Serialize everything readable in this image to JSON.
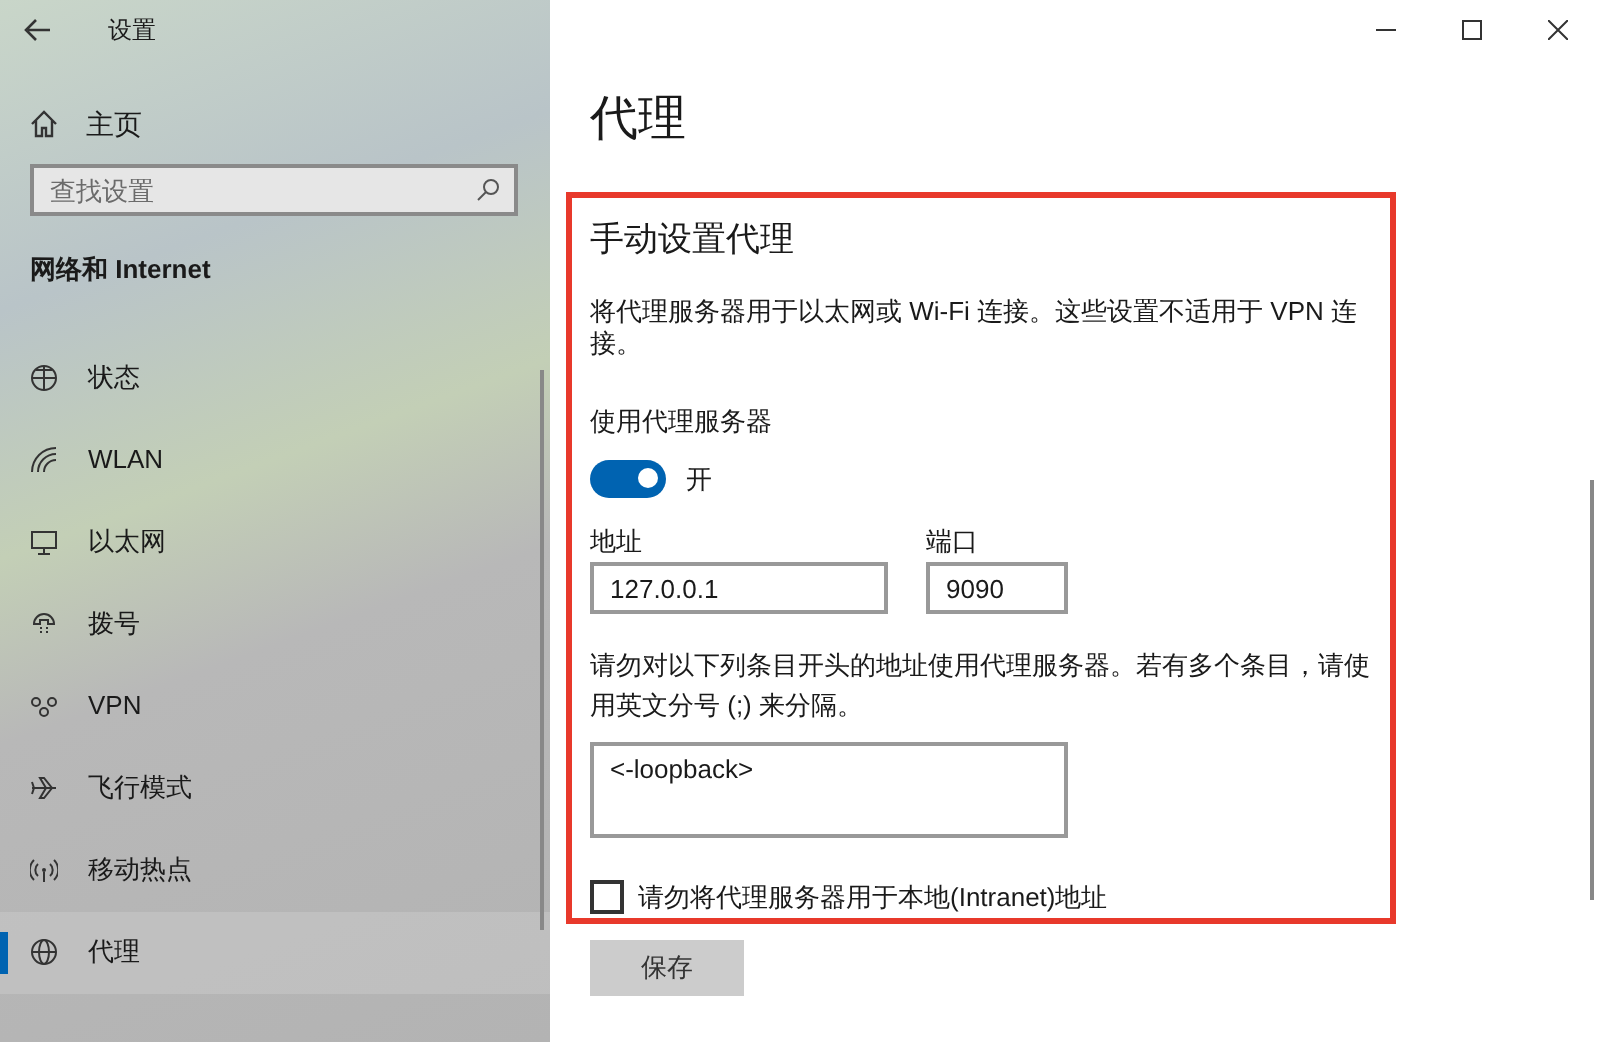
{
  "window": {
    "title": "设置"
  },
  "sidebar": {
    "home": "主页",
    "search": {
      "placeholder": "查找设置"
    },
    "section": "网络和 Internet",
    "items": [
      {
        "label": "状态",
        "selected": false
      },
      {
        "label": "WLAN",
        "selected": false
      },
      {
        "label": "以太网",
        "selected": false
      },
      {
        "label": "拨号",
        "selected": false
      },
      {
        "label": "VPN",
        "selected": false
      },
      {
        "label": "飞行模式",
        "selected": false
      },
      {
        "label": "移动热点",
        "selected": false
      },
      {
        "label": "代理",
        "selected": true
      }
    ]
  },
  "page": {
    "title": "代理",
    "manual": {
      "title": "手动设置代理",
      "description": "将代理服务器用于以太网或 Wi-Fi 连接。这些设置不适用于 VPN 连接。",
      "toggle": {
        "label": "使用代理服务器",
        "on": true,
        "state_text": "开"
      },
      "address": {
        "label": "地址",
        "value": "127.0.0.1"
      },
      "port": {
        "label": "端口",
        "value": "9090"
      },
      "exceptions": {
        "description": "请勿对以下列条目开头的地址使用代理服务器。若有多个条目，请使用英文分号 (;) 来分隔。",
        "value": "<-loopback>"
      },
      "bypass_local": {
        "label": "请勿将代理服务器用于本地(Intranet)地址",
        "checked": false
      }
    },
    "save_button": "保存"
  }
}
